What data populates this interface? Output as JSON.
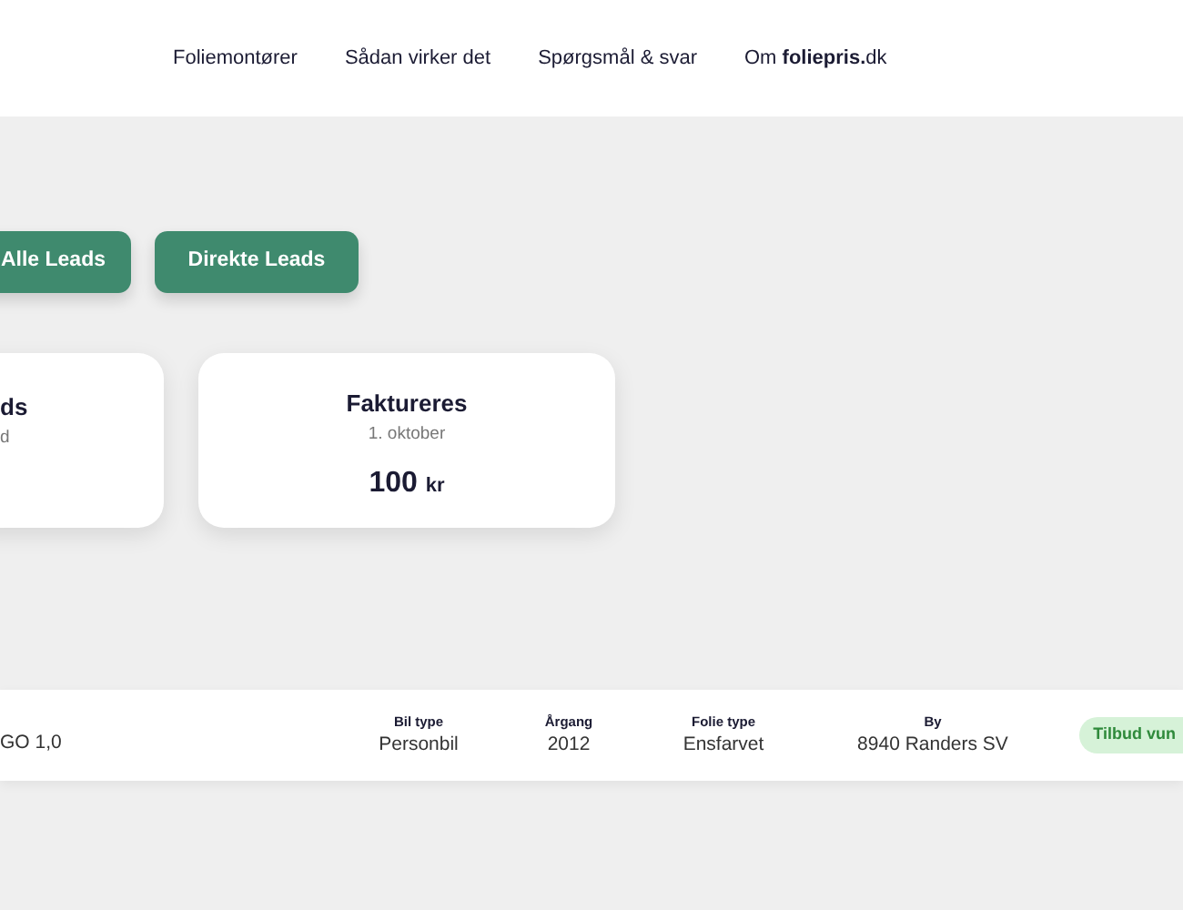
{
  "nav": {
    "links": [
      {
        "label": "Foliemontører"
      },
      {
        "label": "Sådan virker det"
      },
      {
        "label": "Spørgsmål & svar"
      },
      {
        "label": "Om **foliepris.**dk"
      }
    ]
  },
  "filter_buttons": [
    {
      "label": "Alle Leads"
    },
    {
      "label": "Direkte Leads"
    }
  ],
  "summary_cards": [
    {
      "title": "ds",
      "subtitle": "d"
    },
    {
      "title": "Faktureres",
      "subtitle": "1. oktober",
      "amount": "100",
      "unit": "kr"
    }
  ],
  "lead_row": {
    "vehicle": "GO 1,0",
    "fields": [
      {
        "label": "Bil type",
        "value": "Personbil"
      },
      {
        "label": "Årgang",
        "value": "2012"
      },
      {
        "label": "Folie type",
        "value": "Ensfarvet"
      },
      {
        "label": "By",
        "value": "8940 Randers SV"
      }
    ],
    "status": "Tilbud vun"
  }
}
